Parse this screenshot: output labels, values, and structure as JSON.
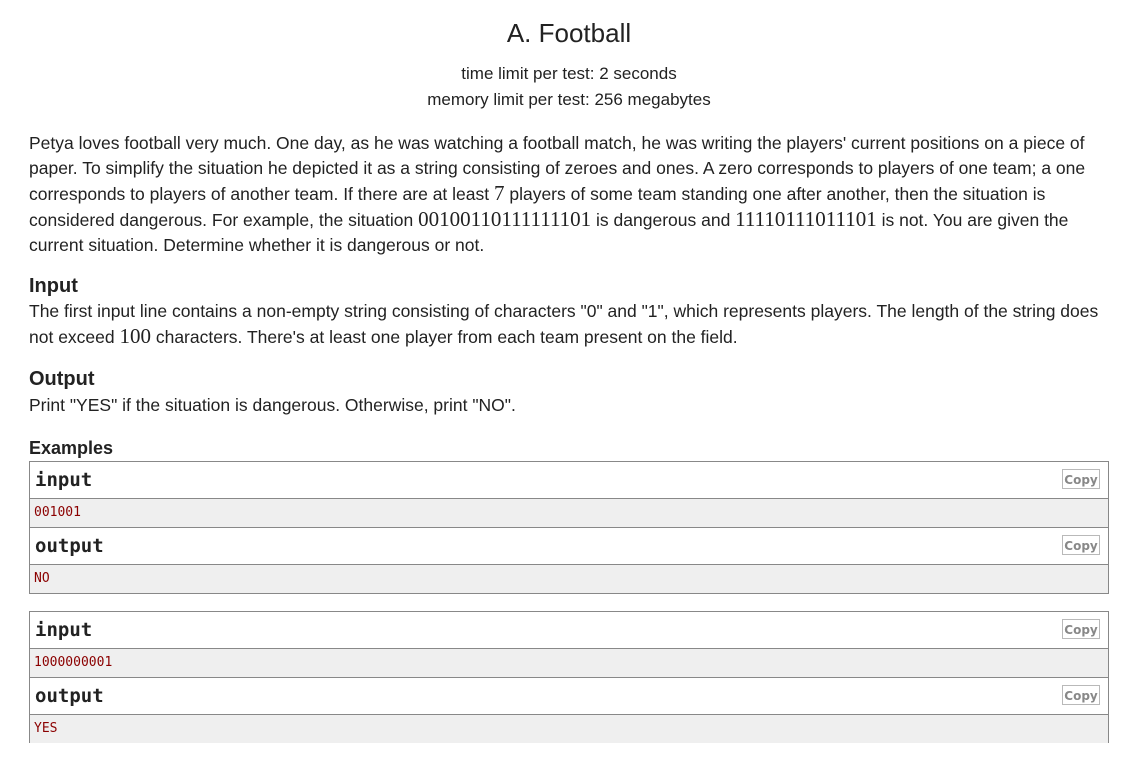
{
  "problem": {
    "title": "A. Football",
    "time_limit": "time limit per test: 2 seconds",
    "memory_limit": "memory limit per test: 256 megabytes",
    "legend": {
      "line1": "Petya loves football very much. One day, as he was watching a football match, he was writing the players' current positions on a piece of",
      "line2": "paper. To simplify the situation he depicted it as a string consisting of zeroes and ones. A zero corresponds to players of one team; a one",
      "line3_a": "corresponds to players of another team. If there are at least ",
      "line3_math": "7",
      "line3_b": " players of some team standing one after another, then the situation is",
      "line4_a": "considered dangerous. For example, the situation ",
      "line4_math1": "00100110111111101",
      "line4_b": " is dangerous and ",
      "line4_math2": "11110111011101",
      "line4_c": " is not. You are given the",
      "line5": "current situation. Determine whether it is dangerous or not."
    },
    "input_section": {
      "title": "Input",
      "line1": "The first input line contains a non-empty string consisting of characters \"0\" and \"1\", which represents players. The length of the string does",
      "line2_a": "not exceed ",
      "line2_math": "100",
      "line2_b": " characters. There's at least one player from each team present on the field."
    },
    "output_section": {
      "title": "Output",
      "text": "Print \"YES\" if the situation is dangerous. Otherwise, print \"NO\"."
    },
    "examples": {
      "title": "Examples",
      "copy_label": "Copy",
      "tests": [
        {
          "input_label": "input",
          "input_value": "001001",
          "output_label": "output",
          "output_value": "NO"
        },
        {
          "input_label": "input",
          "input_value": "1000000001",
          "output_label": "output",
          "output_value": "YES"
        }
      ]
    }
  },
  "colors": {
    "text": "#222222",
    "border": "#888888",
    "sample_bg": "#efefef",
    "sample_text": "#8b0000",
    "copy_text": "#888888"
  }
}
